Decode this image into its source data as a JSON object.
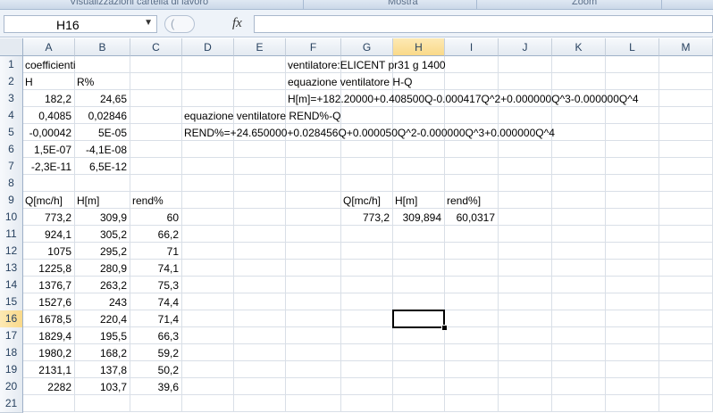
{
  "ribbon": {
    "group_labels": [
      "Visualizzazioni cartella di lavoro",
      "Mostra",
      "Zoom"
    ]
  },
  "formula_bar": {
    "name_box": "H16",
    "fx_label": "fx",
    "formula": ""
  },
  "columns": [
    "A",
    "B",
    "C",
    "D",
    "E",
    "F",
    "G",
    "H",
    "I",
    "J",
    "K",
    "L",
    "M"
  ],
  "rows": [
    "1",
    "2",
    "3",
    "4",
    "5",
    "6",
    "7",
    "8",
    "9",
    "10",
    "11",
    "12",
    "13",
    "14",
    "15",
    "16",
    "17",
    "18",
    "19",
    "20",
    "21"
  ],
  "active_cell": {
    "column": "H",
    "row": "16"
  },
  "cells": {
    "A1": "coefficienti",
    "A2": "H",
    "B2": "R%",
    "A3": "182,2",
    "B3": "24,65",
    "A4": "0,4085",
    "B4": "0,02846",
    "A5": "-0,00042",
    "B5": "5E-05",
    "A6": "1,5E-07",
    "B6": "-4,1E-08",
    "A7": "-2,3E-11",
    "B7": "6,5E-12",
    "F1": "ventilatore:ELICENT pr31 g 1400",
    "F2": "equazione ventilatore H-Q",
    "F3": " H[m]=+182.20000+0.408500Q-0.000417Q^2+0.000000Q^3-0.000000Q^4",
    "D4": "equazione ventilatore REND%-Q",
    "D5": "REND%=+24.650000+0.028456Q+0.000050Q^2-0.000000Q^3+0.000000Q^4",
    "A9": "Q[mc/h]",
    "B9": "H[m]",
    "C9": "rend%",
    "G9": "Q[mc/h]",
    "H9": "H[m]",
    "I9": "rend%]",
    "G10": "773,2",
    "H10": "309,894",
    "I10": "60,0317"
  },
  "table": [
    [
      "773,2",
      "309,9",
      "60"
    ],
    [
      "924,1",
      "305,2",
      "66,2"
    ],
    [
      "1075",
      "295,2",
      "71"
    ],
    [
      "1225,8",
      "280,9",
      "74,1"
    ],
    [
      "1376,7",
      "263,2",
      "75,3"
    ],
    [
      "1527,6",
      "243",
      "74,4"
    ],
    [
      "1678,5",
      "220,4",
      "71,4"
    ],
    [
      "1829,4",
      "195,5",
      "66,3"
    ],
    [
      "1980,2",
      "168,2",
      "59,2"
    ],
    [
      "2131,1",
      "137,8",
      "50,2"
    ],
    [
      "2282",
      "103,7",
      "39,6"
    ]
  ]
}
